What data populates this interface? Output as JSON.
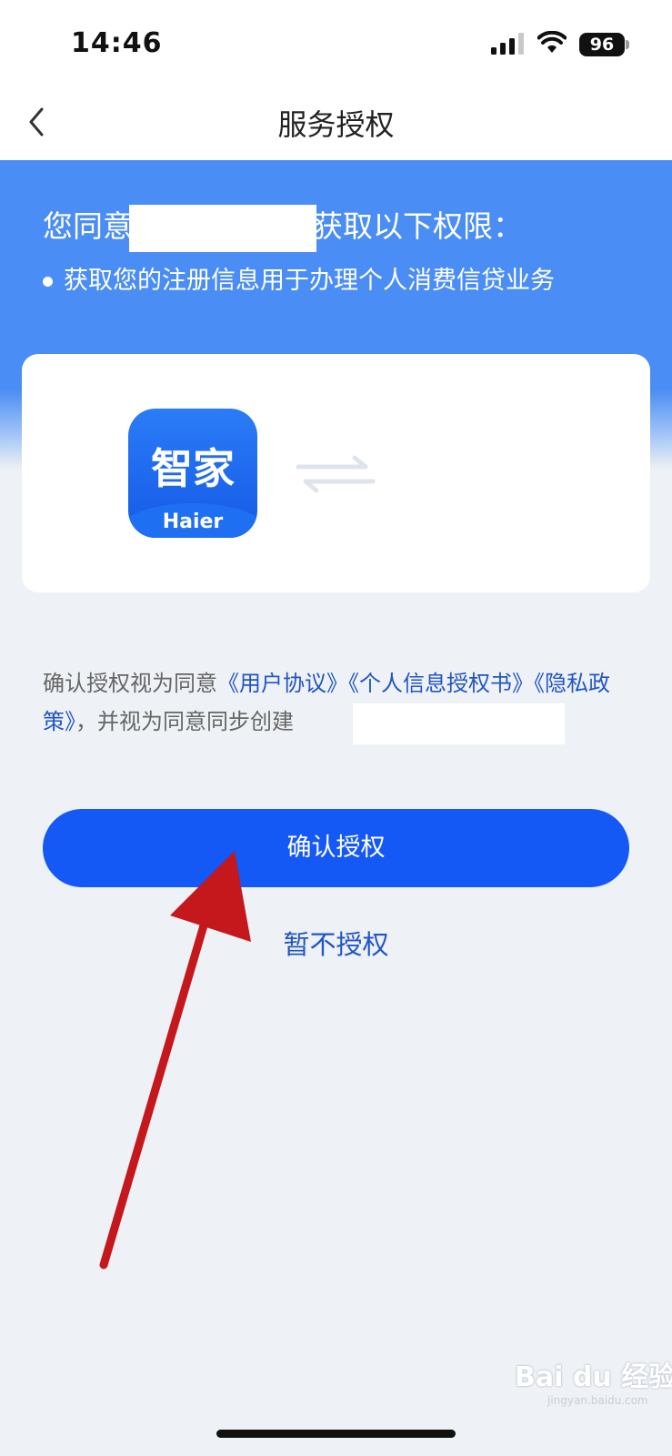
{
  "status_bar": {
    "time": "14:46",
    "battery": "96"
  },
  "nav": {
    "title": "服务授权"
  },
  "hero": {
    "title_prefix": "您同意",
    "title_suffix": "获取以下权限：",
    "bullet": "获取您的注册信息用于办理个人消费信贷业务"
  },
  "app_card": {
    "app_icon": {
      "chars": "智家",
      "brand": "Haier"
    }
  },
  "agreement": {
    "prefix": "确认授权视为同意",
    "link_user": "《用户协议》",
    "link_personal_info": "《个人信息授权书》",
    "link_privacy": "《隐私政策》",
    "suffix": "，并视为同意同步创建"
  },
  "actions": {
    "confirm_label": "确认授权",
    "decline_label": "暂不授权"
  },
  "watermark": {
    "text": "Bai du 经验",
    "sub": "jingyan.baidu.com"
  },
  "colors": {
    "primary_button": "#1458f6",
    "hero_blue": "#4a8df4",
    "link": "#2156c4",
    "annotation_arrow": "#c4181c"
  }
}
